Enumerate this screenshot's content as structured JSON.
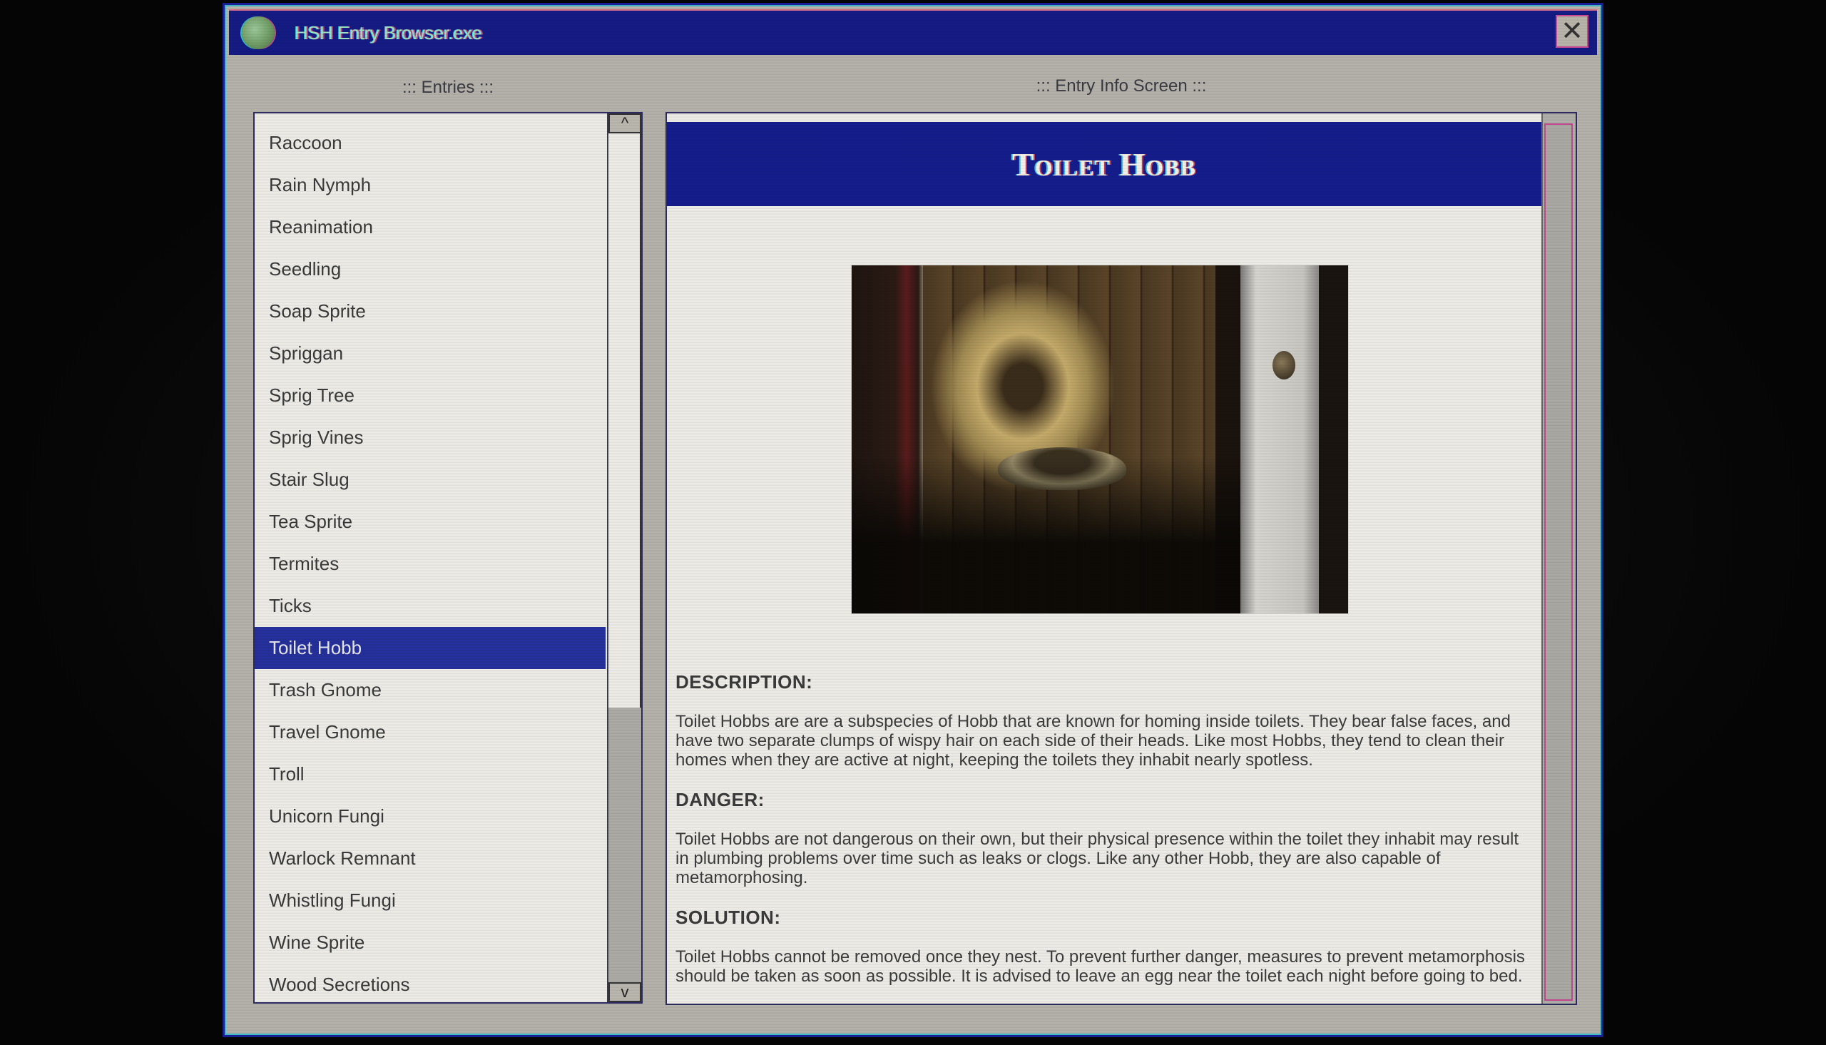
{
  "window": {
    "title": "HSH Entry Browser.exe",
    "app_icon": "globe-icon",
    "close_icon": "close-x-icon",
    "close_glyph": "✕"
  },
  "entries_panel": {
    "label": "::: Entries :::",
    "scroll_up_glyph": "^",
    "scroll_down_glyph": "v",
    "selected_index": 12,
    "items": [
      "Raccoon",
      "Rain Nymph",
      "Reanimation",
      "Seedling",
      "Soap Sprite",
      "Spriggan",
      "Sprig Tree",
      "Sprig Vines",
      "Stair Slug",
      "Tea Sprite",
      "Termites",
      "Ticks",
      "Toilet Hobb",
      "Trash Gnome",
      "Travel Gnome",
      "Troll",
      "Unicorn Fungi",
      "Warlock Remnant",
      "Whistling Fungi",
      "Wine Sprite",
      "Wood Secretions"
    ]
  },
  "info_panel": {
    "label": "::: Entry Info Screen :::",
    "entry_title": "Toilet Hobb",
    "image_alt": "Dim wooden bathroom stall with a toilet, seen through a half-open white door",
    "sections": [
      {
        "heading": "DESCRIPTION:",
        "body": "Toilet Hobbs are are a subspecies of Hobb that are known for homing inside toilets. They bear false faces, and have two separate clumps of wispy hair on each side of their heads. Like most Hobbs, they tend to clean their homes when they are active at night, keeping the toilets they inhabit nearly spotless."
      },
      {
        "heading": "DANGER:",
        "body": "Toilet Hobbs are not dangerous on their own, but their physical presence within the toilet they inhabit may result in plumbing problems over time such as leaks or clogs. Like any other Hobb, they are also capable of metamorphosing."
      },
      {
        "heading": "SOLUTION:",
        "body": "Toilet Hobbs cannot be removed once they nest. To prevent further danger, measures to prevent metamorphosis should be taken as soon as possible. It is advised to leave an egg near the toilet each night before going to bed."
      }
    ]
  },
  "colors": {
    "titlebar": "#141b82",
    "selection": "#25309a",
    "entry_header": "#151c8c",
    "window_bg": "#b4b1aa",
    "panel_bg": "#ecebe6"
  }
}
